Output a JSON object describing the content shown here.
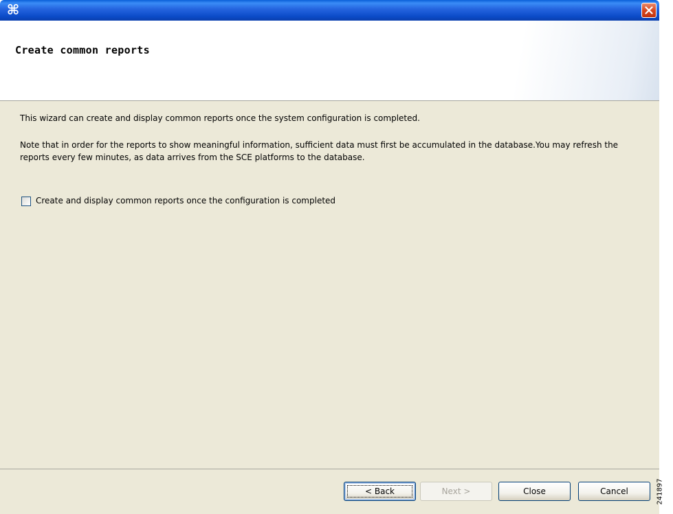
{
  "window": {
    "icon": "app-logo-icon",
    "close_icon": "close-icon"
  },
  "banner": {
    "title": "Create common reports"
  },
  "content": {
    "paragraph1": "This wizard can create and display common reports once the system configuration is completed.",
    "paragraph2": "Note that in order for the reports to show meaningful information, sufficient data must first be accumulated in the database.You may refresh the reports every few minutes, as data arrives from the SCE platforms to the database.",
    "checkbox_label": "Create and display common reports once the configuration is completed",
    "checkbox_checked": false
  },
  "buttons": {
    "back": "< Back",
    "next": "Next >",
    "close": "Close",
    "cancel": "Cancel"
  },
  "figure_id": "241897",
  "colors": {
    "titlebar": "#2463de",
    "dialog_bg": "#ece9d8",
    "close_button": "#d6471f"
  }
}
